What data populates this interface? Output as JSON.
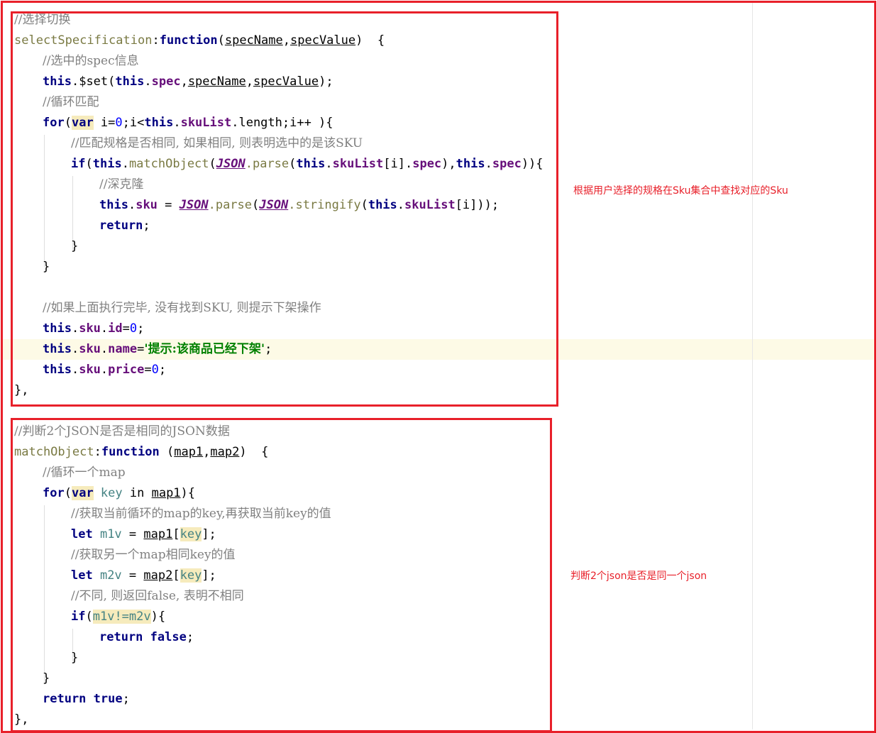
{
  "colors": {
    "annotation_red": "#e8202a",
    "keyword": "#000080",
    "property": "#660e7a",
    "comment": "#808080",
    "string": "#008000",
    "number": "#0000ff",
    "line_highlight": "#fdfae6"
  },
  "block1": {
    "line1": "//选择切换",
    "line2": {
      "fname": "selectSpecification",
      "colon": ":",
      "kw": "function",
      "open": "(",
      "p1": "specName",
      "comma": ",",
      "p2": "specValue",
      "close": ")  {"
    },
    "line3": "//选中的spec信息",
    "line4": {
      "this": "this",
      "dot": ".",
      "set": "$set",
      "open": "(",
      "this2": "this",
      "dot2": ".",
      "spec": "spec",
      "comma": ",",
      "p1": "specName",
      "comma2": ",",
      "p2": "specValue",
      "close": ");"
    },
    "line5": "//循环匹配",
    "line6": {
      "for": "for",
      "open": "(",
      "var": "var",
      "i": " i=",
      "zero": "0",
      "rest1": ";i<",
      "this": "this",
      "dot": ".",
      "skuList": "skuList",
      "rest2": ".length;i++ ){"
    },
    "line7": "//匹配规格是否相同, 如果相同, 则表明选中的是该SKU",
    "line8": {
      "if": "if",
      "open": "(",
      "this": "this",
      "dot": ".",
      "match": "matchObject",
      "open2": "(",
      "json": "JSON",
      "parse": ".parse",
      "open3": "(",
      "this2": "this",
      "dot2": ".",
      "skuList": "skuList",
      "idx": "[i].",
      "spec": "spec",
      "mid": "),",
      "this3": "this",
      "dot3": ".",
      "spec2": "spec",
      "close": ")){"
    },
    "line9": "//深克隆",
    "line10": {
      "this": "this",
      "dot": ".",
      "sku": "sku",
      "eq": " = ",
      "json": "JSON",
      "parse": ".parse",
      "open": "(",
      "json2": "JSON",
      "stringify": ".stringify",
      "open2": "(",
      "this2": "this",
      "dot2": ".",
      "skuList": "skuList",
      "close": "[i]));"
    },
    "line11": {
      "ret": "return",
      "semi": ";"
    },
    "line12": "}",
    "line13": "}",
    "line15": "//如果上面执行完毕, 没有找到SKU, 则提示下架操作",
    "line16": {
      "this": "this",
      "dot": ".",
      "sku": "sku",
      "dot2": ".",
      "prop": "id",
      "eq": "=",
      "val": "0",
      "semi": ";"
    },
    "line17": {
      "this": "this",
      "dot": ".",
      "sku": "sku",
      "dot2": ".",
      "prop": "name",
      "eq": "=",
      "val": "'提示:该商品已经下架'",
      "semi": ";"
    },
    "line18": {
      "this": "this",
      "dot": ".",
      "sku": "sku",
      "dot2": ".",
      "prop": "price",
      "eq": "=",
      "val": "0",
      "semi": ";"
    },
    "line19": "},"
  },
  "block2": {
    "line1": "//判断2个JSON是否是相同的JSON数据",
    "line2": {
      "fname": "matchObject",
      "colon": ":",
      "kw": "function",
      "open": " (",
      "p1": "map1",
      "comma": ",",
      "p2": "map2",
      "close": ")  {"
    },
    "line3": "//循环一个map",
    "line4": {
      "for": "for",
      "open": "(",
      "var": "var",
      "key": " key",
      "in": " in ",
      "map": "map1",
      "close": "){"
    },
    "line5": "//获取当前循环的map的key,再获取当前key的值",
    "line6": {
      "let": "let",
      "name": " m1v",
      "eq": " = ",
      "map": "map1",
      "open": "[",
      "key": "key",
      "close": "];"
    },
    "line7": "//获取另一个map相同key的值",
    "line8": {
      "let": "let",
      "name": " m2v",
      "eq": " = ",
      "map": "map2",
      "open": "[",
      "key": "key",
      "close": "];"
    },
    "line9": "//不同, 则返回false, 表明不相同",
    "line10": {
      "if": "if",
      "open": "(",
      "cond": "m1v!=m2v",
      "close": "){"
    },
    "line11": {
      "ret": "return",
      "val": " false",
      "semi": ";"
    },
    "line12": "}",
    "line13": "}",
    "line14": {
      "ret": "return",
      "val": " true",
      "semi": ";"
    },
    "line15": "},"
  },
  "annotations": {
    "note1": "根据用户选择的规格在Sku集合中查找对应的Sku",
    "note2": "判断2个json是否是同一个json"
  }
}
